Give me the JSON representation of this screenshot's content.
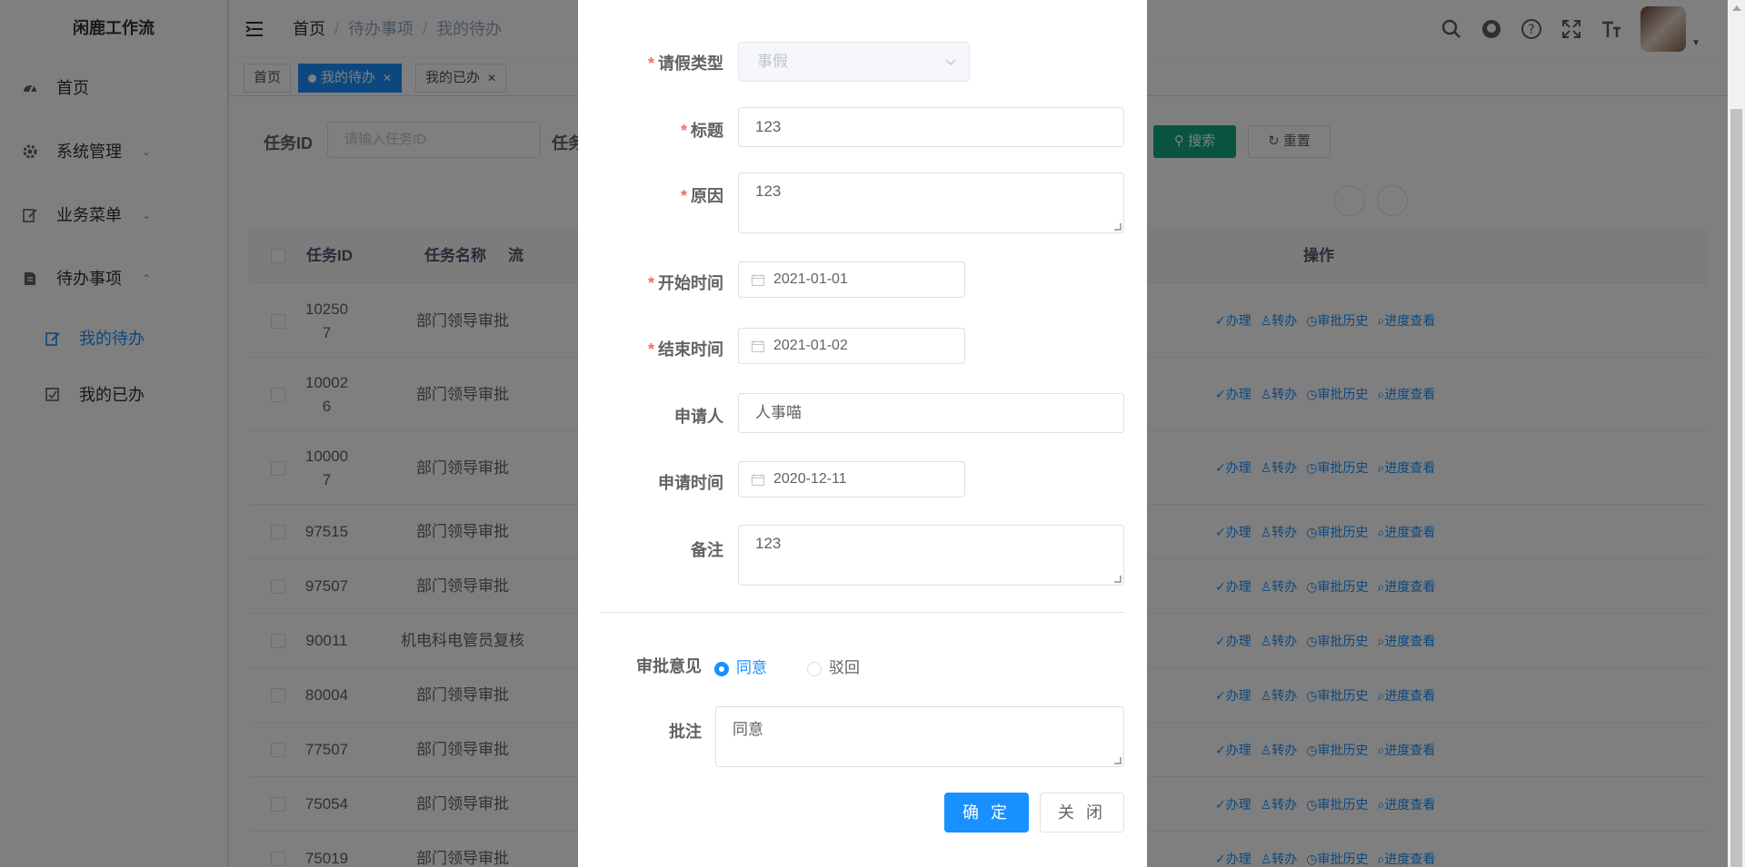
{
  "app": {
    "logo": "闲鹿工作流"
  },
  "sidebar": {
    "items": [
      {
        "label": "首页",
        "icon": "dashboard-icon"
      },
      {
        "label": "系统管理",
        "icon": "gear-icon"
      },
      {
        "label": "业务菜单",
        "icon": "edit-icon"
      },
      {
        "label": "待办事项",
        "icon": "document-icon"
      }
    ],
    "sub_items": [
      {
        "label": "我的待办",
        "icon": "edit-icon",
        "active": true
      },
      {
        "label": "我的已办",
        "icon": "checkbox-icon",
        "active": false
      }
    ]
  },
  "navbar": {
    "breadcrumb": [
      "首页",
      "待办事项",
      "我的待办"
    ],
    "icons": [
      "search-icon",
      "github-icon",
      "question-icon",
      "fullscreen-icon",
      "font-size-icon"
    ]
  },
  "tags": [
    {
      "label": "首页",
      "active": false
    },
    {
      "label": "我的待办",
      "active": true
    },
    {
      "label": "我的已办",
      "active": false
    }
  ],
  "search": {
    "task_id_label": "任务ID",
    "task_id_placeholder": "请输入任务ID",
    "task_label_partial": "任务",
    "search_button": "搜索",
    "reset_button": "重置"
  },
  "table": {
    "headers": {
      "id": "任务ID",
      "name": "任务名称",
      "partial": "流",
      "ops": "操作"
    },
    "ops": [
      "办理",
      "转办",
      "审批历史",
      "进度查看"
    ],
    "rows": [
      {
        "id": "102507",
        "id_lines": [
          "10250",
          "7"
        ],
        "name": "部门领导审批"
      },
      {
        "id": "100026",
        "id_lines": [
          "10002",
          "6"
        ],
        "name": "部门领导审批"
      },
      {
        "id": "100007",
        "id_lines": [
          "10000",
          "7"
        ],
        "name": "部门领导审批"
      },
      {
        "id": "97515",
        "id_lines": [
          "97515"
        ],
        "name": "部门领导审批"
      },
      {
        "id": "97507",
        "id_lines": [
          "97507"
        ],
        "name": "部门领导审批"
      },
      {
        "id": "90011",
        "id_lines": [
          "90011"
        ],
        "name": "机电科电管员复核"
      },
      {
        "id": "80004",
        "id_lines": [
          "80004"
        ],
        "name": "部门领导审批"
      },
      {
        "id": "77507",
        "id_lines": [
          "77507"
        ],
        "name": "部门领导审批"
      },
      {
        "id": "75054",
        "id_lines": [
          "75054"
        ],
        "name": "部门领导审批"
      },
      {
        "id": "75019",
        "id_lines": [
          "75019"
        ],
        "name": "部门领导审批"
      }
    ]
  },
  "dialog": {
    "leave_type_label": "请假类型",
    "leave_type_value": "事假",
    "title_label": "标题",
    "title_value": "123",
    "reason_label": "原因",
    "reason_value": "123",
    "start_label": "开始时间",
    "start_value": "2021-01-01",
    "end_label": "结束时间",
    "end_value": "2021-01-02",
    "applicant_label": "申请人",
    "applicant_value": "人事喵",
    "apply_time_label": "申请时间",
    "apply_time_value": "2020-12-11",
    "remark_label": "备注",
    "remark_value": "123",
    "opinion_label": "审批意见",
    "opinion_options": [
      "同意",
      "驳回"
    ],
    "opinion_selected": "同意",
    "comment_label": "批注",
    "comment_value": "同意",
    "confirm_button": "确 定",
    "close_button": "关 闭"
  },
  "colors": {
    "primary": "#1890ff",
    "search_button": "#11a983",
    "required": "#f56c6c"
  }
}
